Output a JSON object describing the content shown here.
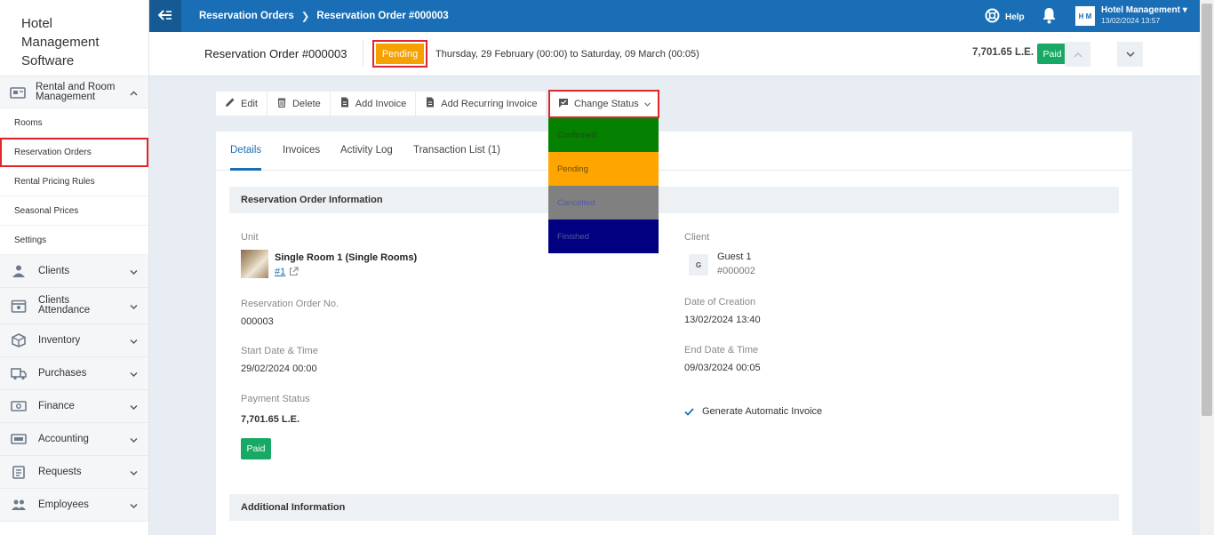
{
  "brand": {
    "line1": "Hotel",
    "line2": "Management",
    "line3": "Software"
  },
  "sidebar": {
    "section": {
      "label": "Rental and Room Management",
      "icon": "rental-room-icon"
    },
    "sub_items": [
      {
        "label": "Rooms"
      },
      {
        "label": "Reservation Orders",
        "active": true
      },
      {
        "label": "Rental Pricing Rules"
      },
      {
        "label": "Seasonal Prices"
      },
      {
        "label": "Settings"
      }
    ],
    "items": [
      {
        "label": "Clients",
        "icon": "clients-icon"
      },
      {
        "label": "Clients Attendance",
        "icon": "attendance-icon"
      },
      {
        "label": "Inventory",
        "icon": "inventory-icon"
      },
      {
        "label": "Purchases",
        "icon": "purchases-icon"
      },
      {
        "label": "Finance",
        "icon": "finance-icon"
      },
      {
        "label": "Accounting",
        "icon": "accounting-icon"
      },
      {
        "label": "Requests",
        "icon": "requests-icon"
      },
      {
        "label": "Employees",
        "icon": "employees-icon"
      }
    ]
  },
  "topbar": {
    "breadcrumb": [
      "Reservation Orders",
      "Reservation Order #000003"
    ],
    "help_label": "Help",
    "user_initials": "H M",
    "user_name": "Hotel Management",
    "user_date": "13/02/2024 13:57"
  },
  "header": {
    "title": "Reservation Order #000003",
    "status": "Pending",
    "date_range": "Thursday, 29 February (00:00) to Saturday, 09 March (00:05)",
    "total": "7,701.65 L.E.",
    "payment_badge": "Paid"
  },
  "toolbar": {
    "edit": "Edit",
    "delete": "Delete",
    "add_invoice": "Add Invoice",
    "add_recurring": "Add Recurring Invoice",
    "change_status": "Change Status"
  },
  "status_menu": [
    {
      "label": "Confirmed",
      "bg": "#058000",
      "fg": "#1f4a1a"
    },
    {
      "label": "Pending",
      "bg": "#ffa500",
      "fg": "#6e4a10"
    },
    {
      "label": "Cancelled",
      "bg": "#808080",
      "fg": "#4f5aa8"
    },
    {
      "label": "Finished",
      "bg": "#000080",
      "fg": "#5a5aa0"
    }
  ],
  "tabs": [
    "Details",
    "Invoices",
    "Activity Log",
    "Transaction List (1)"
  ],
  "info": {
    "section_title": "Reservation Order Information",
    "unit_label": "Unit",
    "unit_name": "Single Room 1 (Single Rooms)",
    "unit_link": "#1",
    "client_label": "Client",
    "client_initial": "G",
    "client_name": "Guest 1",
    "client_code": "#000002",
    "order_no_label": "Reservation Order No.",
    "order_no": "000003",
    "creation_label": "Date of Creation",
    "creation_value": "13/02/2024 13:40",
    "start_label": "Start Date & Time",
    "start_value": "29/02/2024 00:00",
    "end_label": "End Date & Time",
    "end_value": "09/03/2024 00:05",
    "payment_label": "Payment Status",
    "payment_amount": "7,701.65 L.E.",
    "payment_badge": "Paid",
    "auto_invoice": "Generate Automatic Invoice"
  },
  "additional": {
    "section_title": "Additional Information"
  },
  "colors": {
    "primary": "#1a6eb5",
    "paid": "#17a965",
    "pending": "#f5a100",
    "highlight": "#e0262b"
  }
}
